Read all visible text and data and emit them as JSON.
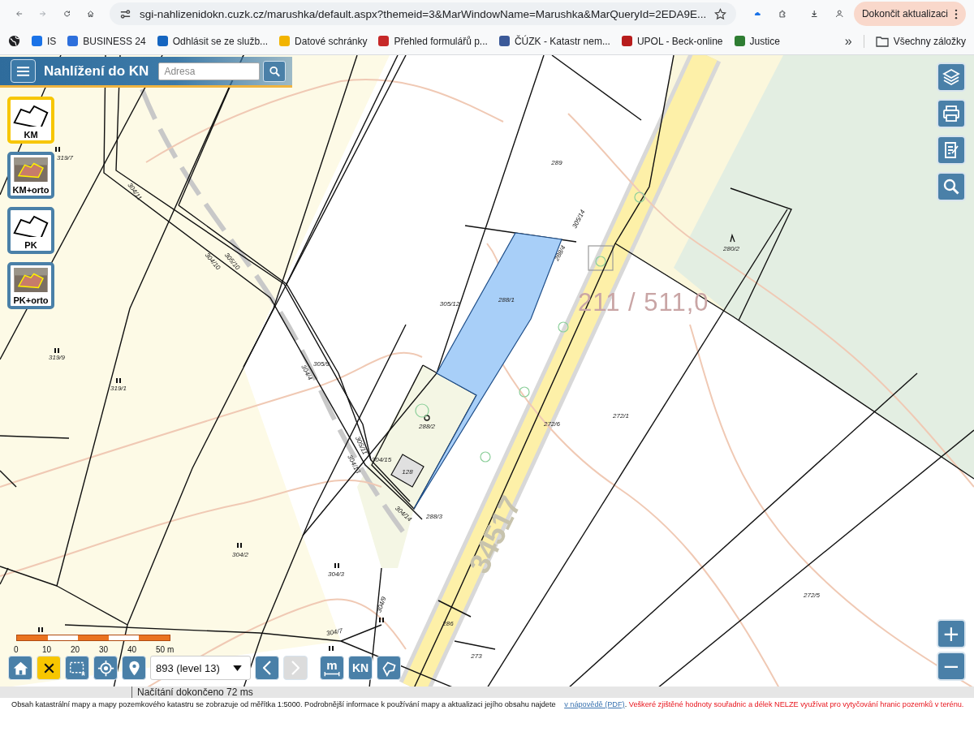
{
  "browser": {
    "url": "sgi-nahlizenidokn.cuzk.cz/marushka/default.aspx?themeid=3&MarWindowName=Marushka&MarQueryId=2EDA9E...",
    "update_button": "Dokončit aktualizaci",
    "bookmarks": [
      "IS",
      "BUSINESS 24",
      "Odhlásit se ze služb...",
      "Datové schránky",
      "Přehled formulářů p...",
      "ČÚZK - Katastr nem...",
      "UPOL - Beck-online",
      "Justice"
    ],
    "more_bookmarks": "»",
    "all_bookmarks": "Všechny záložky"
  },
  "app": {
    "title": "Nahlížení do KN",
    "search": {
      "placeholder": "Adresa"
    }
  },
  "layers": [
    {
      "label": "KM",
      "selected": true
    },
    {
      "label": "KM+orto",
      "selected": false
    },
    {
      "label": "PK",
      "selected": false
    },
    {
      "label": "PK+orto",
      "selected": false
    }
  ],
  "map": {
    "parcel_labels": [
      "319/7",
      "304/11",
      "304/10",
      "305/10",
      "289",
      "305/14",
      "288/4",
      "280/2",
      "305/12",
      "288/1",
      "319/9",
      "319/1",
      "305/9",
      "304/4",
      "288/2",
      "272/6",
      "272/1",
      "305/11",
      "304/13",
      "304/15",
      "128",
      "304/14",
      "288/3",
      "304/2",
      "304/3",
      "272/5",
      "304/9",
      "286",
      "304/7",
      "273"
    ],
    "area_label": "211 / 511,0",
    "road_label": "34517"
  },
  "scale": {
    "ticks": [
      "0",
      "10",
      "20",
      "30",
      "40",
      "50 m"
    ]
  },
  "toolbar": {
    "zoom_level": "893 (level 13)",
    "back": {
      "disabled": false
    },
    "forward": {
      "disabled": true
    },
    "measure_label": "m",
    "kn_label": "KN"
  },
  "zoom": {
    "in": "+",
    "out": "−"
  },
  "status": "Načítání dokončeno 72 ms",
  "footer": {
    "info": "Obsah katastrální mapy a mapy pozemkového katastru se zobrazuje od měřítka 1:5000. Podrobnější informace k používání mapy a aktualizaci jejího obsahu najdete",
    "link": "v nápovědě (PDF)",
    "info_end": ".",
    "warning": "Veškeré zjištěné hodnoty souřadnic a délek NELZE využívat pro vytyčování hranic pozemků v terénu."
  }
}
